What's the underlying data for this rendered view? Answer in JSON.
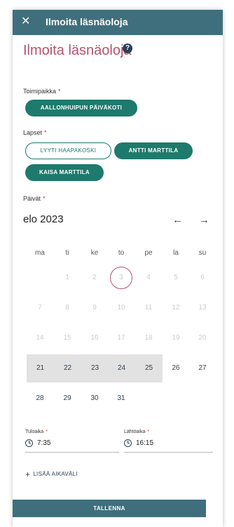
{
  "header": {
    "close_icon": "close-icon",
    "title": "Ilmoita läsnäoloja"
  },
  "page": {
    "heading": "Ilmoita läsnäoloja",
    "help_icon": "?"
  },
  "unit": {
    "label": "Toimipaikka",
    "required_mark": "*",
    "selected": "AALLONHUIPUN PÄIVÄKOTI"
  },
  "children": {
    "label": "Lapset",
    "required_mark": "*",
    "items": [
      {
        "name": "LYYTI HAAPAKOSKI",
        "selected": false
      },
      {
        "name": "ANTTI MARTTILA",
        "selected": true
      },
      {
        "name": "KAISA MARTTILA",
        "selected": true
      }
    ]
  },
  "days": {
    "label": "Päivät",
    "required_mark": "*",
    "month": "elo 2023",
    "prev_icon": "←",
    "next_icon": "→",
    "weekdays": [
      "ma",
      "ti",
      "ke",
      "to",
      "pe",
      "la",
      "su"
    ],
    "weeks": [
      [
        {
          "d": "",
          "s": "none"
        },
        {
          "d": "1",
          "s": "disabled"
        },
        {
          "d": "2",
          "s": "disabled"
        },
        {
          "d": "3",
          "s": "today"
        },
        {
          "d": "4",
          "s": "disabled"
        },
        {
          "d": "5",
          "s": "disabled"
        },
        {
          "d": "6",
          "s": "disabled"
        }
      ],
      [
        {
          "d": "7",
          "s": "disabled"
        },
        {
          "d": "8",
          "s": "disabled"
        },
        {
          "d": "9",
          "s": "disabled"
        },
        {
          "d": "10",
          "s": "disabled"
        },
        {
          "d": "11",
          "s": "disabled"
        },
        {
          "d": "12",
          "s": "disabled"
        },
        {
          "d": "13",
          "s": "disabled"
        }
      ],
      [
        {
          "d": "14",
          "s": "disabled"
        },
        {
          "d": "15",
          "s": "disabled"
        },
        {
          "d": "16",
          "s": "disabled"
        },
        {
          "d": "17",
          "s": "disabled"
        },
        {
          "d": "18",
          "s": "disabled"
        },
        {
          "d": "19",
          "s": "disabled"
        },
        {
          "d": "20",
          "s": "disabled"
        }
      ],
      [
        {
          "d": "21",
          "s": "selected"
        },
        {
          "d": "22",
          "s": "selected"
        },
        {
          "d": "23",
          "s": "selected"
        },
        {
          "d": "24",
          "s": "selected"
        },
        {
          "d": "25",
          "s": "selected"
        },
        {
          "d": "26",
          "s": "enabled"
        },
        {
          "d": "27",
          "s": "enabled"
        }
      ],
      [
        {
          "d": "28",
          "s": "enabled"
        },
        {
          "d": "29",
          "s": "enabled"
        },
        {
          "d": "30",
          "s": "enabled"
        },
        {
          "d": "31",
          "s": "enabled"
        },
        {
          "d": "",
          "s": "none"
        },
        {
          "d": "",
          "s": "none"
        },
        {
          "d": "",
          "s": "none"
        }
      ]
    ]
  },
  "times": {
    "start_label": "Tuloaika",
    "start_value": "7:35",
    "end_label": "Lähtöaika",
    "end_value": "16:15",
    "required_mark": "*"
  },
  "actions": {
    "add_interval": "LISÄÄ AIKAVÄLI",
    "add_icon": "+",
    "save": "TALLENNA"
  },
  "colors": {
    "header_bg": "#3f6f7c",
    "accent_green": "#1e7a6c",
    "heading_pink": "#b5536f",
    "selected_day_bg": "#e2e2e2"
  }
}
